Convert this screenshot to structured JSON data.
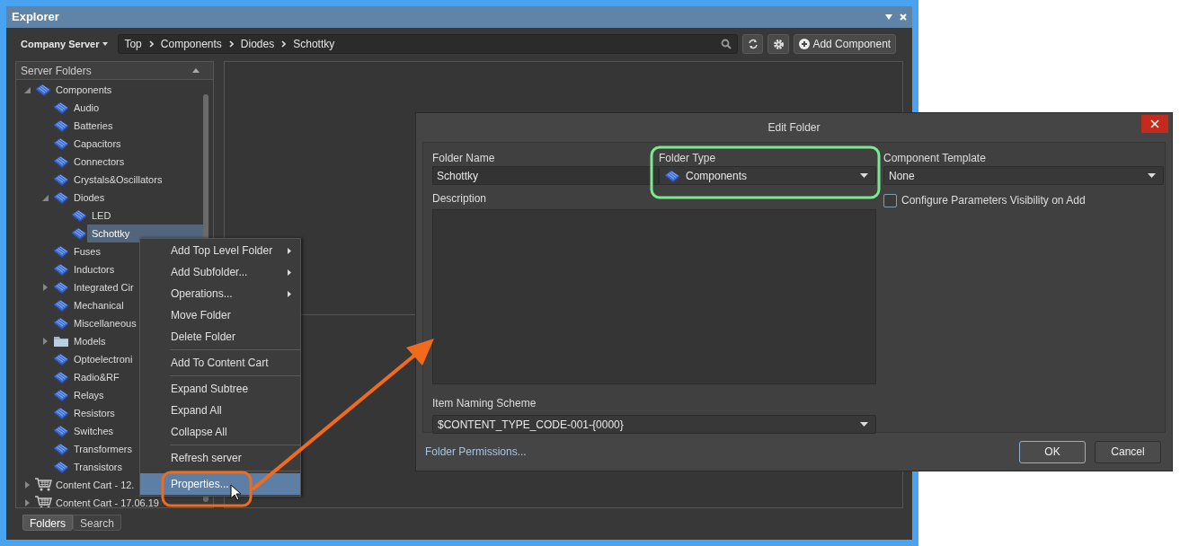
{
  "explorer": {
    "title": "Explorer",
    "server": "Company Server",
    "breadcrumb": [
      "Top",
      "Components",
      "Diodes",
      "Schottky"
    ],
    "add_button": "Add Component",
    "tree_header": "Server Folders",
    "tree": [
      {
        "label": "Components",
        "kind": "component",
        "expanded": true,
        "selected": false,
        "children": [
          {
            "label": "Audio",
            "kind": "component",
            "selected": false
          },
          {
            "label": "Batteries",
            "kind": "component",
            "selected": false
          },
          {
            "label": "Capacitors",
            "kind": "component",
            "selected": false
          },
          {
            "label": "Connectors",
            "kind": "component",
            "selected": false
          },
          {
            "label": "Crystals&Oscillators",
            "kind": "component",
            "selected": false
          },
          {
            "label": "Diodes",
            "kind": "component",
            "expanded": true,
            "selected": false,
            "children": [
              {
                "label": "LED",
                "kind": "component",
                "selected": false
              },
              {
                "label": "Schottky",
                "kind": "component",
                "selected": true
              }
            ]
          },
          {
            "label": "Fuses",
            "kind": "component",
            "selected": false
          },
          {
            "label": "Inductors",
            "kind": "component",
            "selected": false
          },
          {
            "label": "Integrated Cir",
            "kind": "component",
            "expanded": false,
            "selected": false
          },
          {
            "label": "Mechanical",
            "kind": "component",
            "selected": false
          },
          {
            "label": "Miscellaneous",
            "kind": "component",
            "selected": false
          },
          {
            "label": "Models",
            "kind": "folder",
            "expanded": false,
            "selected": false
          },
          {
            "label": "Optoelectroni",
            "kind": "component",
            "selected": false
          },
          {
            "label": "Radio&RF",
            "kind": "component",
            "selected": false
          },
          {
            "label": "Relays",
            "kind": "component",
            "selected": false
          },
          {
            "label": "Resistors",
            "kind": "component",
            "selected": false
          },
          {
            "label": "Switches",
            "kind": "component",
            "selected": false
          },
          {
            "label": "Transformers",
            "kind": "component",
            "selected": false
          },
          {
            "label": "Transistors",
            "kind": "component",
            "selected": false
          }
        ]
      },
      {
        "label": "Content Cart - 12.",
        "kind": "cart",
        "expanded": false,
        "selected": false
      },
      {
        "label": "Content Cart - 17.06.19",
        "kind": "cart",
        "expanded": false,
        "selected": false
      }
    ],
    "tabs": [
      {
        "label": "Folders",
        "selected": true
      },
      {
        "label": "Search",
        "selected": false
      }
    ]
  },
  "context_menu": {
    "groups": [
      [
        {
          "label": "Add Top Level Folder",
          "submenu": true,
          "selected": false
        },
        {
          "label": "Add Subfolder...",
          "submenu": true,
          "selected": false
        },
        {
          "label": "Operations...",
          "submenu": true,
          "selected": false
        },
        {
          "label": "Move Folder",
          "submenu": false,
          "selected": false
        },
        {
          "label": "Delete Folder",
          "submenu": false,
          "selected": false
        }
      ],
      [
        {
          "label": "Add To Content Cart",
          "submenu": false,
          "selected": false
        }
      ],
      [
        {
          "label": "Expand Subtree",
          "submenu": false,
          "selected": false
        },
        {
          "label": "Expand All",
          "submenu": false,
          "selected": false
        },
        {
          "label": "Collapse All",
          "submenu": false,
          "selected": false
        }
      ],
      [
        {
          "label": "Refresh server",
          "submenu": false,
          "selected": false
        }
      ],
      [
        {
          "label": "Properties...",
          "submenu": false,
          "selected": true
        }
      ]
    ]
  },
  "dialog": {
    "title": "Edit Folder",
    "folder_name": {
      "label": "Folder Name",
      "value": "Schottky"
    },
    "folder_type": {
      "label": "Folder Type",
      "value": "Components"
    },
    "component_template": {
      "label": "Component Template",
      "value": "None"
    },
    "description": {
      "label": "Description"
    },
    "checkbox": {
      "label": "Configure Parameters Visibility on Add",
      "checked": false
    },
    "item_naming_scheme": {
      "label": "Item Naming Scheme",
      "value": "$CONTENT_TYPE_CODE-001-{0000}"
    },
    "permissions_link": "Folder Permissions...",
    "buttons": [
      {
        "label": "OK",
        "default": true
      },
      {
        "label": "Cancel",
        "default": false
      }
    ]
  }
}
